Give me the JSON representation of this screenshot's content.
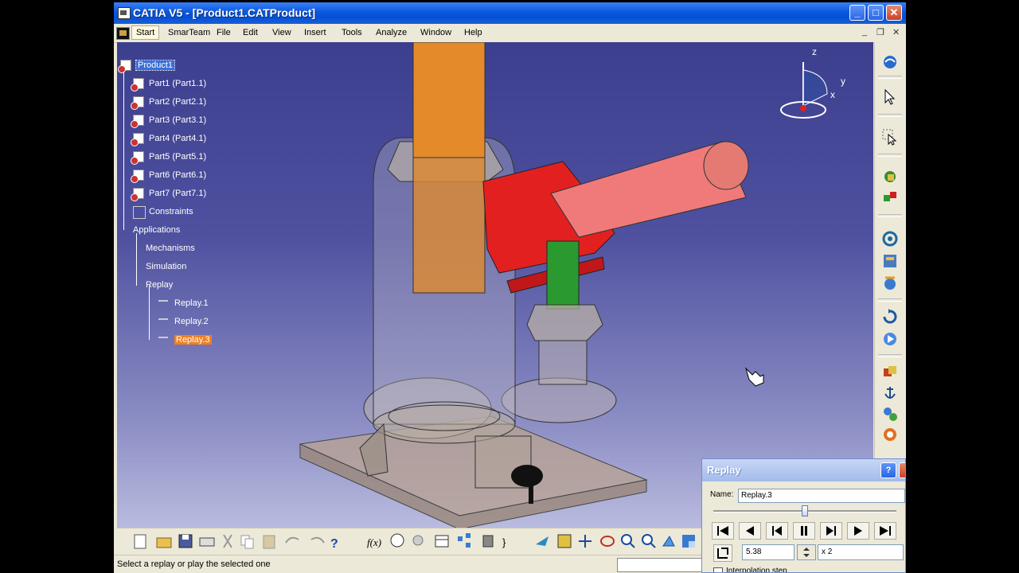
{
  "window": {
    "title": "CATIA V5 - [Product1.CATProduct]",
    "min": "_",
    "max": "□",
    "close": "✕"
  },
  "menu": {
    "start": "Start",
    "items": [
      "SmarTeam",
      "File",
      "Edit",
      "View",
      "Insert",
      "Tools",
      "Analyze",
      "Window",
      "Help"
    ]
  },
  "mdi": {
    "min": "_",
    "restore": "❐",
    "close": "✕"
  },
  "tree": {
    "root": "Product1",
    "parts": [
      "Part1 (Part1.1)",
      "Part2 (Part2.1)",
      "Part3 (Part3.1)",
      "Part4 (Part4.1)",
      "Part5 (Part5.1)",
      "Part6 (Part6.1)",
      "Part7 (Part7.1)"
    ],
    "constraints": "Constraints",
    "applications": "Applications",
    "apps": [
      "Mechanisms",
      "Simulation",
      "Replay"
    ],
    "replays": [
      "Replay.1",
      "Replay.2",
      "Replay.3"
    ]
  },
  "compass": {
    "x": "x",
    "y": "y",
    "z": "z"
  },
  "status": {
    "message": "Select a replay or play the selected one"
  },
  "replay_dialog": {
    "title": "Replay",
    "help": "?",
    "name_label": "Name:",
    "name_value": "Replay.3",
    "slider_fraction": 0.5,
    "time_value": "5.38",
    "speed_value": "x 2",
    "interp_label": "Interpolation step"
  },
  "colors": {
    "title_blue": "#0a58df",
    "viewport_top": "#3c3e8e",
    "viewport_bottom": "#b9bbdf",
    "tree_selected": "#3a6fd8",
    "tree_highlight": "#f08020"
  }
}
